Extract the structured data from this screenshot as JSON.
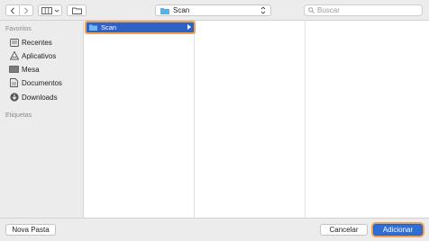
{
  "toolbar": {
    "back_icon": "chevron-left-icon",
    "forward_icon": "chevron-right-icon",
    "view_icon": "columns-view-icon",
    "new_folder_icon": "folder-icon",
    "path": {
      "label": "Scan",
      "icon": "folder-icon"
    },
    "search": {
      "placeholder": "Buscar",
      "icon": "search-icon"
    }
  },
  "sidebar": {
    "favorites_header": "Favoritos",
    "items": [
      {
        "label": "Recentes",
        "icon": "clock-list-icon"
      },
      {
        "label": "Aplicativos",
        "icon": "applications-icon"
      },
      {
        "label": "Mesa",
        "icon": "desktop-icon"
      },
      {
        "label": "Documentos",
        "icon": "document-icon"
      },
      {
        "label": "Downloads",
        "icon": "download-icon"
      }
    ],
    "tags_header": "Etiquetas"
  },
  "browser": {
    "columns": [
      {
        "items": [
          {
            "label": "Scan",
            "selected": true,
            "has_children": true
          }
        ]
      },
      {
        "items": []
      },
      {
        "items": []
      }
    ]
  },
  "bottom": {
    "new_folder_label": "Nova Pasta",
    "cancel_label": "Cancelar",
    "add_label": "Adicionar"
  },
  "colors": {
    "selection": "#2f62c4",
    "focus_ring": "#f0a254",
    "folder": "#5aaee6"
  }
}
